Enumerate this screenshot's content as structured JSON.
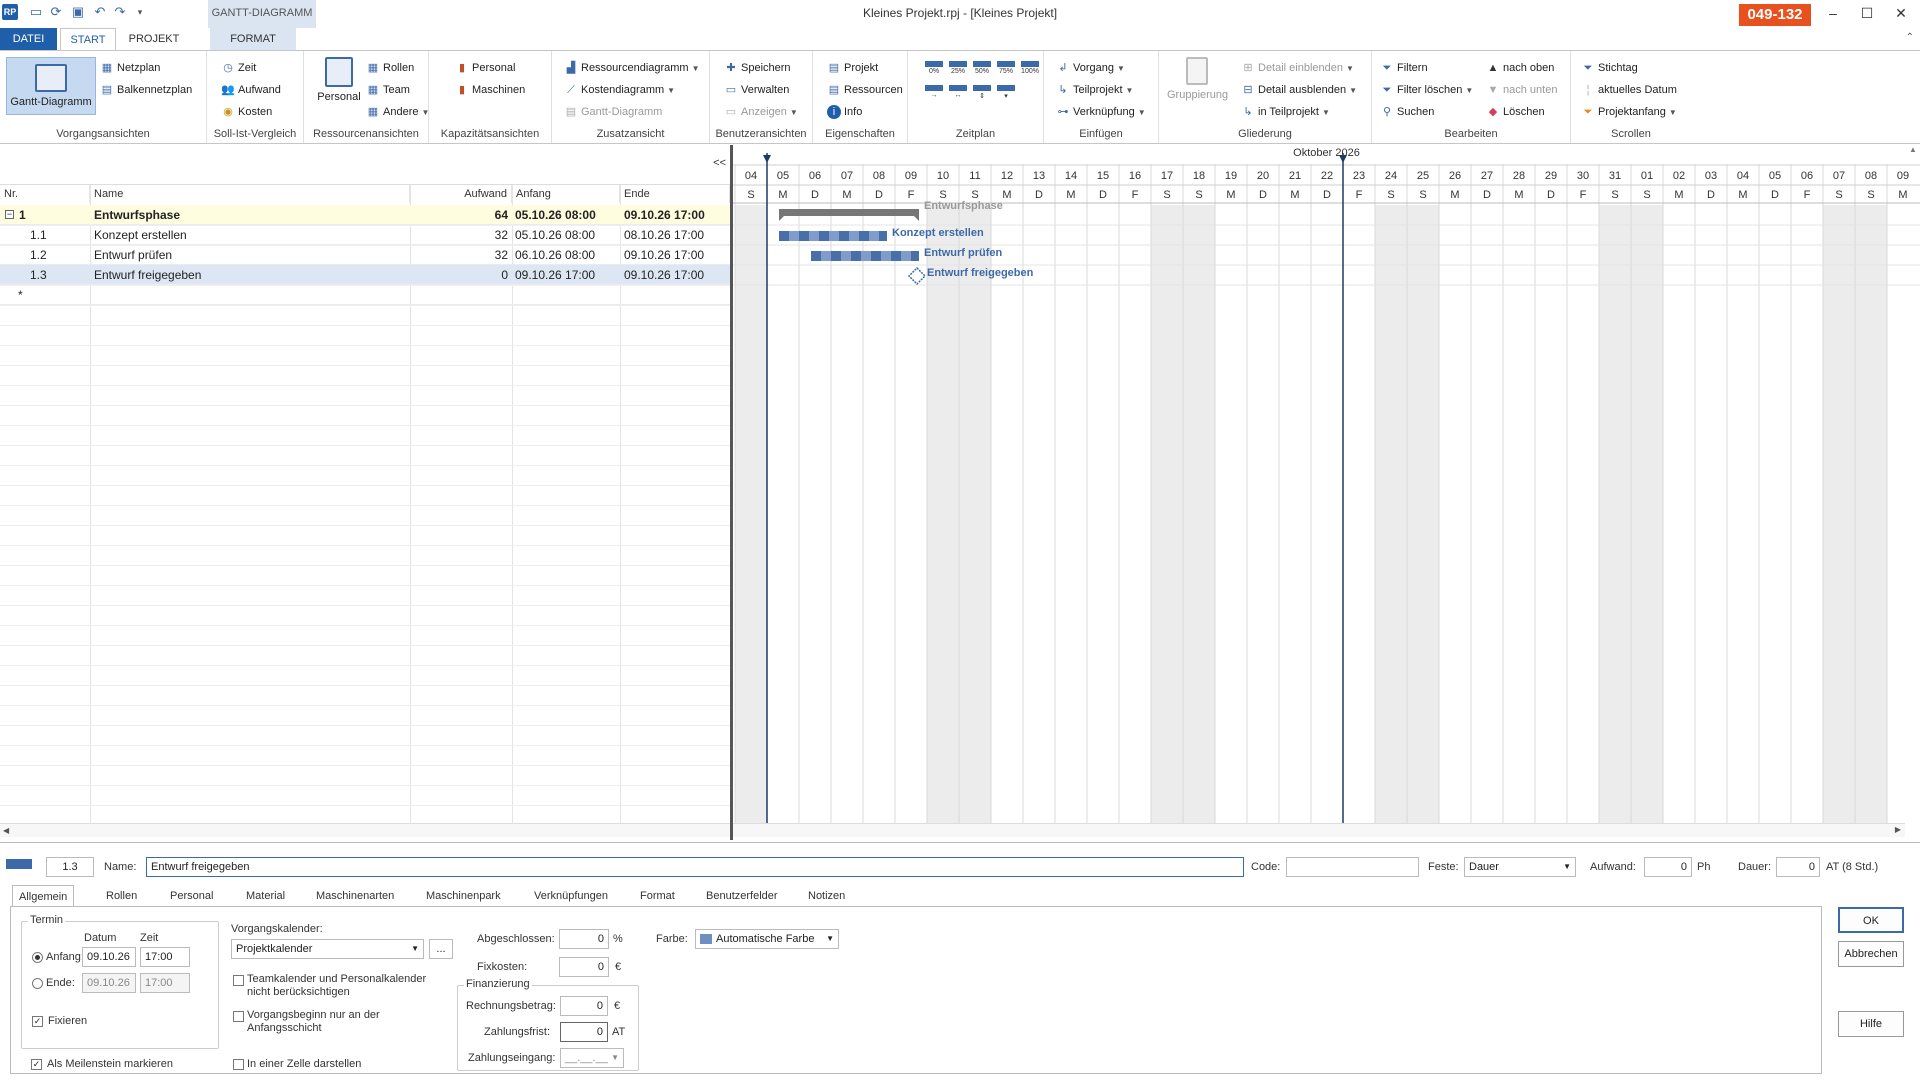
{
  "app": {
    "window_title": "Kleines Projekt.rpj - [Kleines Projekt]",
    "badge": "049-132",
    "context_tab": "GANTT-DIAGRAMM"
  },
  "tabs": [
    "DATEI",
    "START",
    "PROJEKT",
    "FORMAT"
  ],
  "ribbon": {
    "vorgangsansichten": {
      "label": "Vorgangsansichten",
      "big": "Gantt-Diagramm",
      "items": [
        "Netzplan",
        "Balkennetzplan"
      ]
    },
    "soll_ist": {
      "label": "Soll-Ist-Vergleich",
      "items": [
        "Zeit",
        "Aufwand",
        "Kosten"
      ]
    },
    "ressourcen": {
      "label": "Ressourcenansichten",
      "big": "Personal",
      "items": [
        "Rollen",
        "Team",
        "Andere"
      ]
    },
    "kapazitaet": {
      "label": "Kapazitätsansichten",
      "items": [
        "Personal",
        "Maschinen"
      ]
    },
    "zusatz": {
      "label": "Zusatzansicht",
      "items": [
        "Ressourcendiagramm",
        "Kostendiagramm",
        "Gantt-Diagramm"
      ]
    },
    "benutzer": {
      "label": "Benutzeransichten",
      "items": [
        "Speichern",
        "Verwalten",
        "Anzeigen"
      ]
    },
    "eigenschaften": {
      "label": "Eigenschaften",
      "items": [
        "Projekt",
        "Ressourcen",
        "Info"
      ]
    },
    "zeitplan": {
      "label": "Zeitplan",
      "percent": [
        "0%",
        "25%",
        "50%",
        "75%",
        "100%"
      ]
    },
    "einfuegen": {
      "label": "Einfügen",
      "items": [
        "Vorgang",
        "Teilprojekt",
        "Verknüpfung"
      ]
    },
    "gliederung": {
      "label": "Gliederung",
      "big": "Gruppierung",
      "items": [
        "Detail einblenden",
        "Detail ausblenden",
        "in Teilprojekt"
      ]
    },
    "bearbeiten": {
      "label": "Bearbeiten",
      "items": [
        "Filtern",
        "Filter löschen",
        "Suchen",
        "nach oben",
        "nach unten",
        "Löschen"
      ]
    },
    "scrollen": {
      "label": "Scrollen",
      "items": [
        "Stichtag",
        "aktuelles Datum",
        "Projektanfang"
      ]
    }
  },
  "grid": {
    "collapse": "<<",
    "columns": [
      "Nr.",
      "Name",
      "Aufwand",
      "Anfang",
      "Ende"
    ],
    "rows": [
      {
        "nr": "1",
        "name": "Entwurfsphase",
        "aufwand": "64",
        "anfang": "05.10.26 08:00",
        "ende": "09.10.26 17:00"
      },
      {
        "nr": "1.1",
        "name": "Konzept erstellen",
        "aufwand": "32",
        "anfang": "05.10.26 08:00",
        "ende": "08.10.26 17:00"
      },
      {
        "nr": "1.2",
        "name": "Entwurf prüfen",
        "aufwand": "32",
        "anfang": "06.10.26 08:00",
        "ende": "09.10.26 17:00"
      },
      {
        "nr": "1.3",
        "name": "Entwurf freigegeben",
        "aufwand": "0",
        "anfang": "09.10.26 17:00",
        "ende": "09.10.26 17:00"
      }
    ],
    "new_row_marker": "*"
  },
  "gantt": {
    "month": "Oktober 2026",
    "days": [
      "04",
      "05",
      "06",
      "07",
      "08",
      "09",
      "10",
      "11",
      "12",
      "13",
      "14",
      "15",
      "16",
      "17",
      "18",
      "19",
      "20",
      "21",
      "22",
      "23",
      "24",
      "25",
      "26",
      "27",
      "28",
      "29",
      "30",
      "31",
      "01",
      "02",
      "03",
      "04",
      "05",
      "06",
      "07",
      "08",
      "09"
    ],
    "weekdays": [
      "S",
      "M",
      "D",
      "M",
      "D",
      "F",
      "S",
      "S",
      "M",
      "D",
      "M",
      "D",
      "F",
      "S",
      "S",
      "M",
      "D",
      "M",
      "D",
      "F",
      "S",
      "S",
      "M",
      "D",
      "M",
      "D",
      "F",
      "S",
      "S",
      "M",
      "D",
      "M",
      "D",
      "F",
      "S",
      "S",
      "M"
    ],
    "weekend_color": "#ececec",
    "bar_color": "#4a6fa8",
    "summary_color": "#777777",
    "tasks": [
      {
        "label": "Entwurfsphase",
        "start_day": "05",
        "end_day": "09",
        "kind": "summary"
      },
      {
        "label": "Konzept erstellen",
        "start_day": "05",
        "end_day": "08",
        "kind": "task"
      },
      {
        "label": "Entwurf prüfen",
        "start_day": "06",
        "end_day": "09",
        "kind": "task"
      },
      {
        "label": "Entwurf freigegeben",
        "start_day": "09",
        "end_day": "09",
        "kind": "milestone"
      }
    ]
  },
  "detail": {
    "nr": "1.3",
    "name_label": "Name:",
    "name": "Entwurf freigegeben",
    "code_label": "Code:",
    "code": "",
    "feste_label": "Feste:",
    "feste": "Dauer",
    "aufwand_label": "Aufwand:",
    "aufwand": "0",
    "aufwand_unit": "Ph",
    "dauer_label": "Dauer:",
    "dauer": "0",
    "dauer_unit": "AT (8 Std.)",
    "tabs": [
      "Allgemein",
      "Rollen",
      "Personal",
      "Material",
      "Maschinenarten",
      "Maschinenpark",
      "Verknüpfungen",
      "Format",
      "Benutzerfelder",
      "Notizen"
    ],
    "termin": {
      "legend": "Termin",
      "datum_head": "Datum",
      "zeit_head": "Zeit",
      "anfang_label": "Anfang:",
      "anfang_datum": "09.10.26",
      "anfang_zeit": "17:00",
      "ende_label": "Ende:",
      "ende_datum": "09.10.26",
      "ende_zeit": "17:00",
      "fixieren": "Fixieren"
    },
    "meilenstein": "Als Meilenstein markieren",
    "kalender_label": "Vorgangskalender:",
    "kalender": "Projektkalender",
    "kalender_btn": "...",
    "team_check": "Teamkalender und Personalkalender nicht berücksichtigen",
    "anfang_check": "Vorgangsbeginn nur an der Anfangsschicht",
    "zelle_check": "In einer Zelle darstellen",
    "abgeschlossen_label": "Abgeschlossen:",
    "abgeschlossen": "0",
    "abgeschlossen_unit": "%",
    "fixkosten_label": "Fixkosten:",
    "fixkosten": "0",
    "fixkosten_unit": "€",
    "finanzierung": {
      "legend": "Finanzierung",
      "rechnung_label": "Rechnungsbetrag:",
      "rechnung": "0",
      "rechnung_unit": "€",
      "frist_label": "Zahlungsfrist:",
      "frist": "0",
      "frist_unit": "AT",
      "eingang_label": "Zahlungseingang:",
      "eingang": "__.__.__"
    },
    "farbe_label": "Farbe:",
    "farbe": "Automatische Farbe",
    "buttons": {
      "ok": "OK",
      "abbrechen": "Abbrechen",
      "hilfe": "Hilfe"
    }
  }
}
